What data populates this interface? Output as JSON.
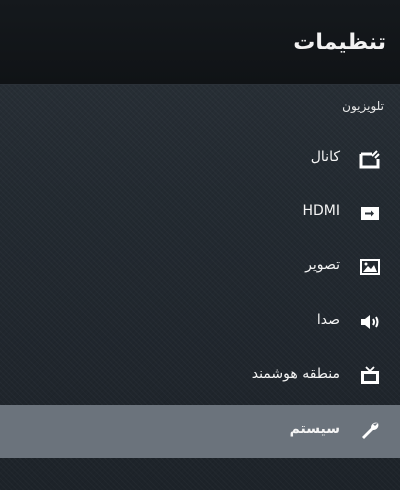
{
  "header": {
    "title": "تنظیمات"
  },
  "section": {
    "label": "تلویزیون"
  },
  "menu": {
    "items": [
      {
        "label": "کانال",
        "icon": "channel-icon",
        "selected": false
      },
      {
        "label": "HDMI",
        "icon": "hdmi-input-icon",
        "selected": false
      },
      {
        "label": "تصویر",
        "icon": "picture-icon",
        "selected": false
      },
      {
        "label": "صدا",
        "icon": "speaker-icon",
        "selected": false
      },
      {
        "label": "منطقه هوشمند",
        "icon": "tv-icon",
        "selected": false
      },
      {
        "label": "سیستم",
        "icon": "wrench-icon",
        "selected": true
      }
    ]
  },
  "colors": {
    "header_background": "#121518",
    "selected_background": "#6b737c",
    "text": "#ffffff"
  }
}
